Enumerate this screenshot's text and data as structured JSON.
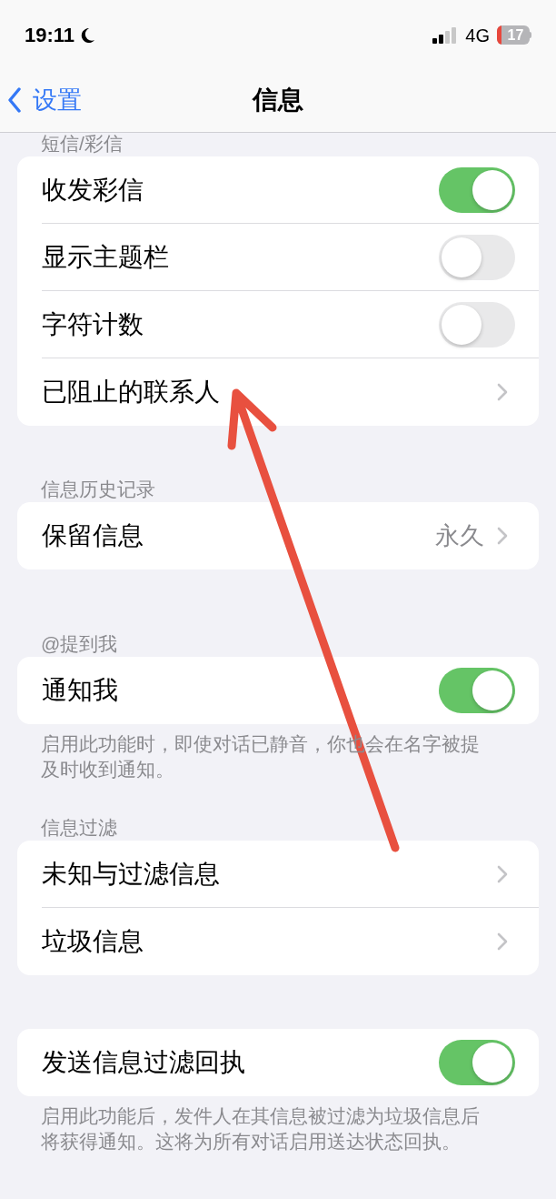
{
  "status_bar": {
    "time": "19:11",
    "network": "4G",
    "battery": "17"
  },
  "nav": {
    "back": "设置",
    "title": "信息"
  },
  "sections": [
    {
      "header": "短信/彩信",
      "rows": [
        {
          "kind": "toggle",
          "label": "收发彩信",
          "on": true
        },
        {
          "kind": "toggle",
          "label": "显示主题栏",
          "on": false
        },
        {
          "kind": "toggle",
          "label": "字符计数",
          "on": false
        },
        {
          "kind": "link",
          "label": "已阻止的联系人"
        }
      ]
    },
    {
      "header": "信息历史记录",
      "rows": [
        {
          "kind": "link",
          "label": "保留信息",
          "value": "永久"
        }
      ]
    },
    {
      "header": "@提到我",
      "rows": [
        {
          "kind": "toggle",
          "label": "通知我",
          "on": true
        }
      ],
      "footer": "启用此功能时，即使对话已静音，你也会在名字被提及时收到通知。"
    },
    {
      "header": "信息过滤",
      "rows": [
        {
          "kind": "link",
          "label": "未知与过滤信息"
        },
        {
          "kind": "link",
          "label": "垃圾信息"
        }
      ]
    },
    {
      "rows": [
        {
          "kind": "toggle",
          "label": "发送信息过滤回执",
          "on": true
        }
      ],
      "footer": "启用此功能后，发件人在其信息被过滤为垃圾信息后将获得通知。这将为所有对话启用送达状态回执。"
    }
  ]
}
